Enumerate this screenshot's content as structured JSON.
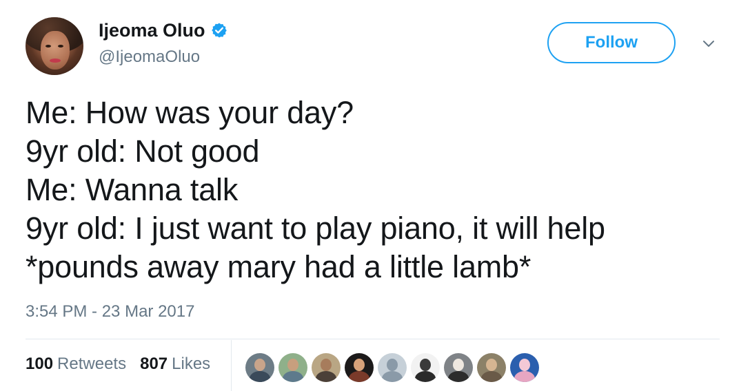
{
  "author": {
    "display_name": "Ijeoma Oluo",
    "handle": "@IjeomaOluo",
    "verified": true
  },
  "actions": {
    "follow_label": "Follow"
  },
  "tweet": {
    "lines": [
      "Me: How was your day?",
      "9yr old: Not good",
      "Me: Wanna talk",
      "9yr old: I just want to play piano, it will help",
      "*pounds away mary had a little lamb*"
    ],
    "timestamp": "3:54 PM - 23 Mar 2017"
  },
  "stats": {
    "retweets_count": "100",
    "retweets_label": "Retweets",
    "likes_count": "807",
    "likes_label": "Likes"
  },
  "likers": [
    {
      "bg": "#6d7c86",
      "head": "#c9a48a",
      "torso": "#3a4a5a"
    },
    {
      "bg": "#8fb08a",
      "head": "#c79f7e",
      "torso": "#5e7a8c"
    },
    {
      "bg": "#b9a684",
      "head": "#a77c5c",
      "torso": "#4b4038"
    },
    {
      "bg": "#1c1a1a",
      "head": "#d8a27a",
      "torso": "#7a3a2a"
    },
    {
      "bg": "#c6d0d8",
      "head": "#8a9aa8",
      "torso": "#8a9aa8"
    },
    {
      "bg": "#f2f2f2",
      "head": "#3a3a3a",
      "torso": "#2a2a2a"
    },
    {
      "bg": "#7f8387",
      "head": "#efe8e0",
      "torso": "#2c2c2c"
    },
    {
      "bg": "#8c8168",
      "head": "#d6b592",
      "torso": "#6a5a48"
    },
    {
      "bg": "#2b5fae",
      "head": "#f4c9d6",
      "torso": "#e7a6c2"
    }
  ],
  "colors": {
    "accent": "#1da1f2",
    "text": "#14171a",
    "muted": "#657786",
    "divider": "#e1e8ed"
  },
  "icons": {
    "verified": "verified-badge-icon",
    "caret": "chevron-down-icon"
  }
}
